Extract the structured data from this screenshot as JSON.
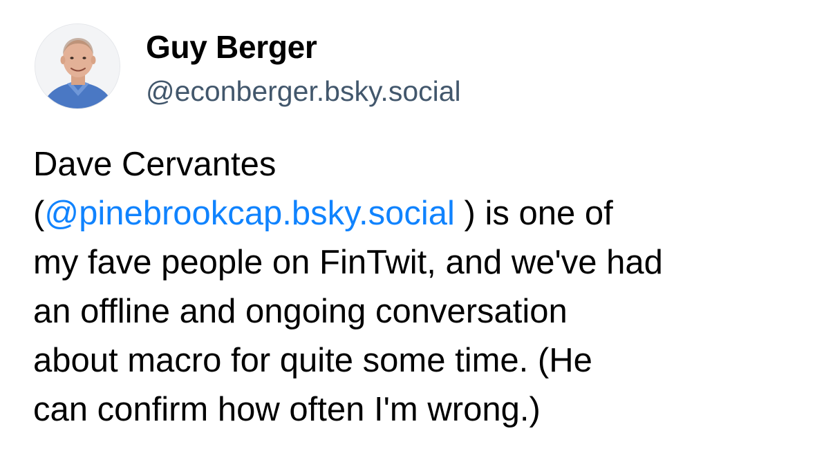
{
  "author": {
    "display_name": "Guy Berger",
    "handle": "@econberger.bsky.social",
    "avatar": "profile-photo"
  },
  "post": {
    "line1": "Dave Cervantes",
    "line2_open": "(",
    "mention": "@pinebrookcap.bsky.social",
    "line2_close": " ) is one of",
    "line3": "my fave people on FinTwit, and we've had",
    "line4": "an offline and ongoing conversation",
    "line5": "about macro for quite some time.  (He",
    "line6": "can confirm how often I'm wrong.)"
  },
  "colors": {
    "mention": "#1083fe",
    "handle": "#42576c",
    "text": "#000000",
    "background": "#ffffff"
  }
}
